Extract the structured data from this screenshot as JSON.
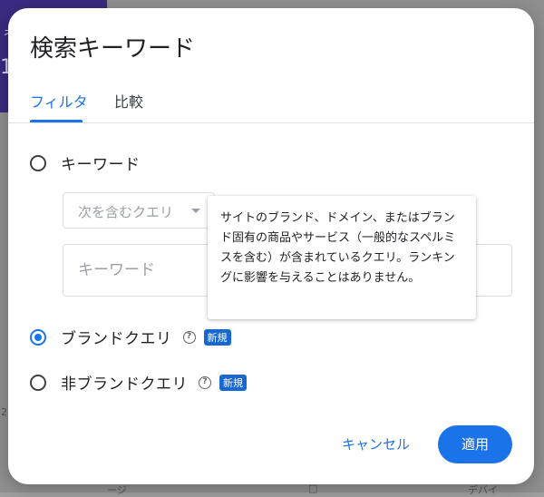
{
  "background": {
    "card_fragment_top": "ネ",
    "card_fragment_number": "1",
    "left_axis_fragment": "2",
    "bottom_fragment_1": "ージ",
    "bottom_fragment_2": "□",
    "bottom_fragment_3": "デバイ"
  },
  "dialog": {
    "title": "検索キーワード",
    "tabs": [
      {
        "label": "フィルタ",
        "active": true
      },
      {
        "label": "比較",
        "active": false
      }
    ],
    "options": [
      {
        "label": "キーワード",
        "checked": false
      },
      {
        "label": "ブランドクエリ",
        "checked": true,
        "help": "?",
        "badge": "新規"
      },
      {
        "label": "非ブランドクエリ",
        "checked": false,
        "help": "?",
        "badge": "新規"
      }
    ],
    "match_select": {
      "value": "次を含むクエリ"
    },
    "keyword_input": {
      "placeholder": "キーワード",
      "value": ""
    },
    "tooltip": "サイトのブランド、ドメイン、またはブランド固有の商品やサービス（一般的なスペルミスを含む）が含まれているクエリ。ランキングに影響を与えることはありません。",
    "cancel_label": "キャンセル",
    "apply_label": "適用"
  },
  "colors": {
    "accent": "#1a73e8",
    "badge": "#1967d2",
    "overlay": "#8f8f8f",
    "card_bg": "#3b2a80"
  }
}
